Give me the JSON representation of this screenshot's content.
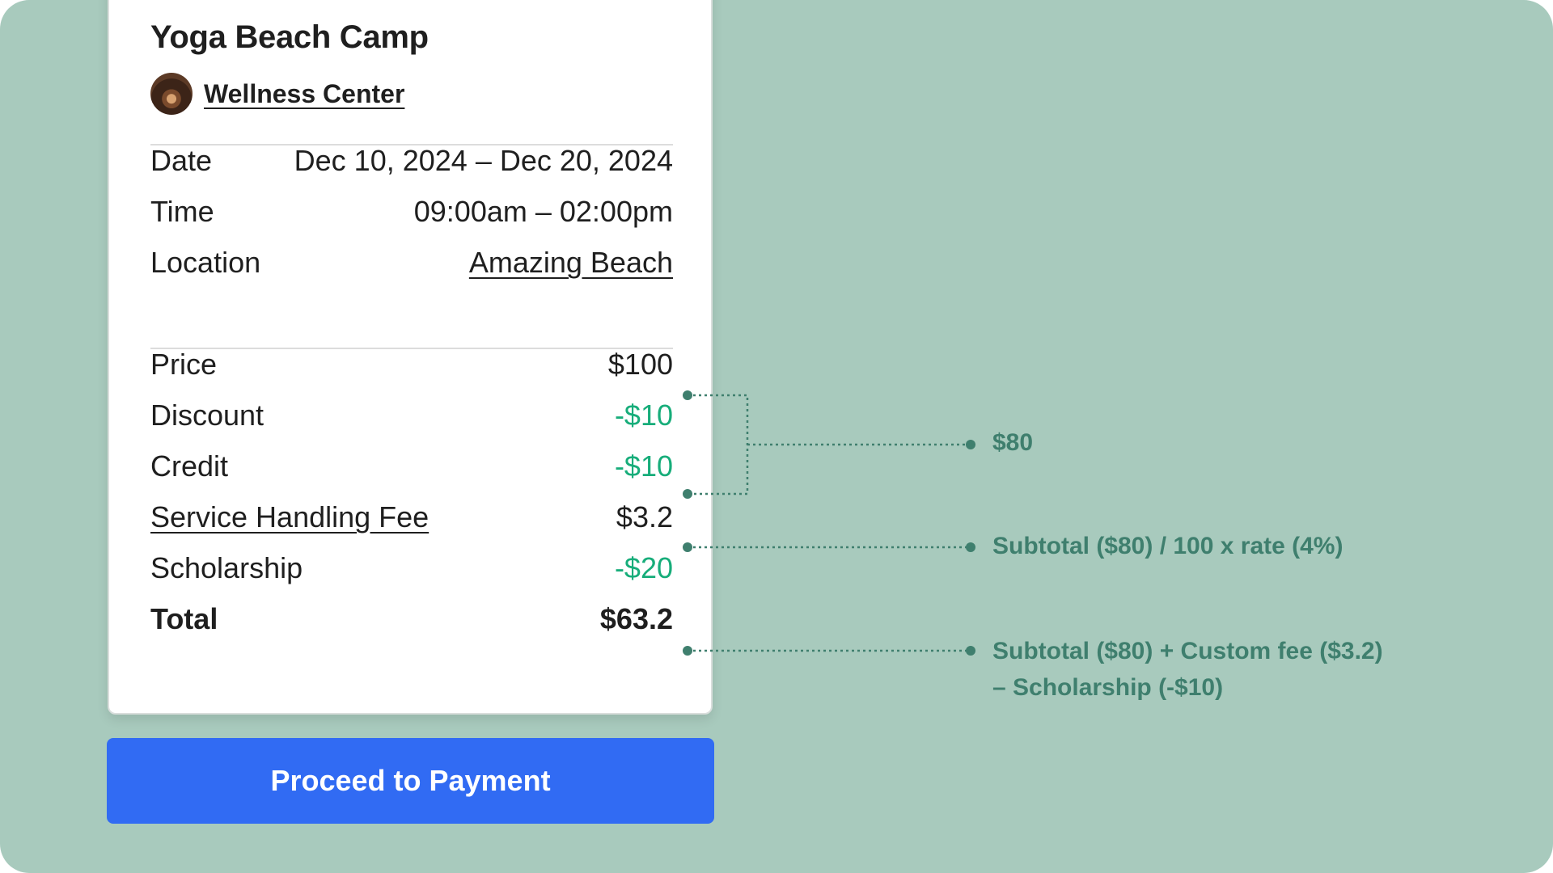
{
  "event": {
    "title": "Yoga Beach Camp",
    "organizer": "Wellness Center"
  },
  "details": [
    {
      "label": "Date",
      "value": "Dec 10, 2024 – Dec 20, 2024"
    },
    {
      "label": "Time",
      "value": "09:00am – 02:00pm"
    },
    {
      "label": "Location",
      "value": "Amazing Beach"
    }
  ],
  "pricing": [
    {
      "label": "Price",
      "value": "$100"
    },
    {
      "label": "Discount",
      "value": "-$10"
    },
    {
      "label": "Credit",
      "value": "-$10"
    },
    {
      "label": "Service Handling Fee",
      "value": "$3.2"
    },
    {
      "label": "Scholarship",
      "value": "-$20"
    },
    {
      "label": "Total",
      "value": "$63.2"
    }
  ],
  "button": {
    "label": "Proceed to Payment"
  },
  "annotations": {
    "subtotal": "$80",
    "fee_formula": "Subtotal ($80) / 100 x rate (4%)",
    "total_formula_line1": "Subtotal ($80) + Custom fee ($3.2)",
    "total_formula_line2": "– Scholarship (-$10)"
  },
  "colors": {
    "background": "#a8cabd",
    "discount_green": "#17ad7a",
    "annotation": "#3f7f6e",
    "button": "#316bf3"
  }
}
